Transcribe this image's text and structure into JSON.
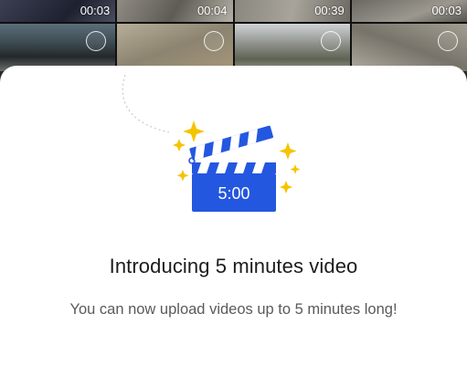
{
  "gallery": {
    "tiles": [
      {
        "duration": "00:03"
      },
      {
        "duration": "00:04"
      },
      {
        "duration": "00:39"
      },
      {
        "duration": "00:03"
      }
    ]
  },
  "announcement": {
    "illustration": {
      "icon": "clapperboard-icon",
      "label": "5:00",
      "accent_color": "#2457e0",
      "sparkle_color": "#f5c400"
    },
    "title": "Introducing 5 minutes video",
    "subtitle": "You can now upload videos up to 5 minutes long!"
  }
}
